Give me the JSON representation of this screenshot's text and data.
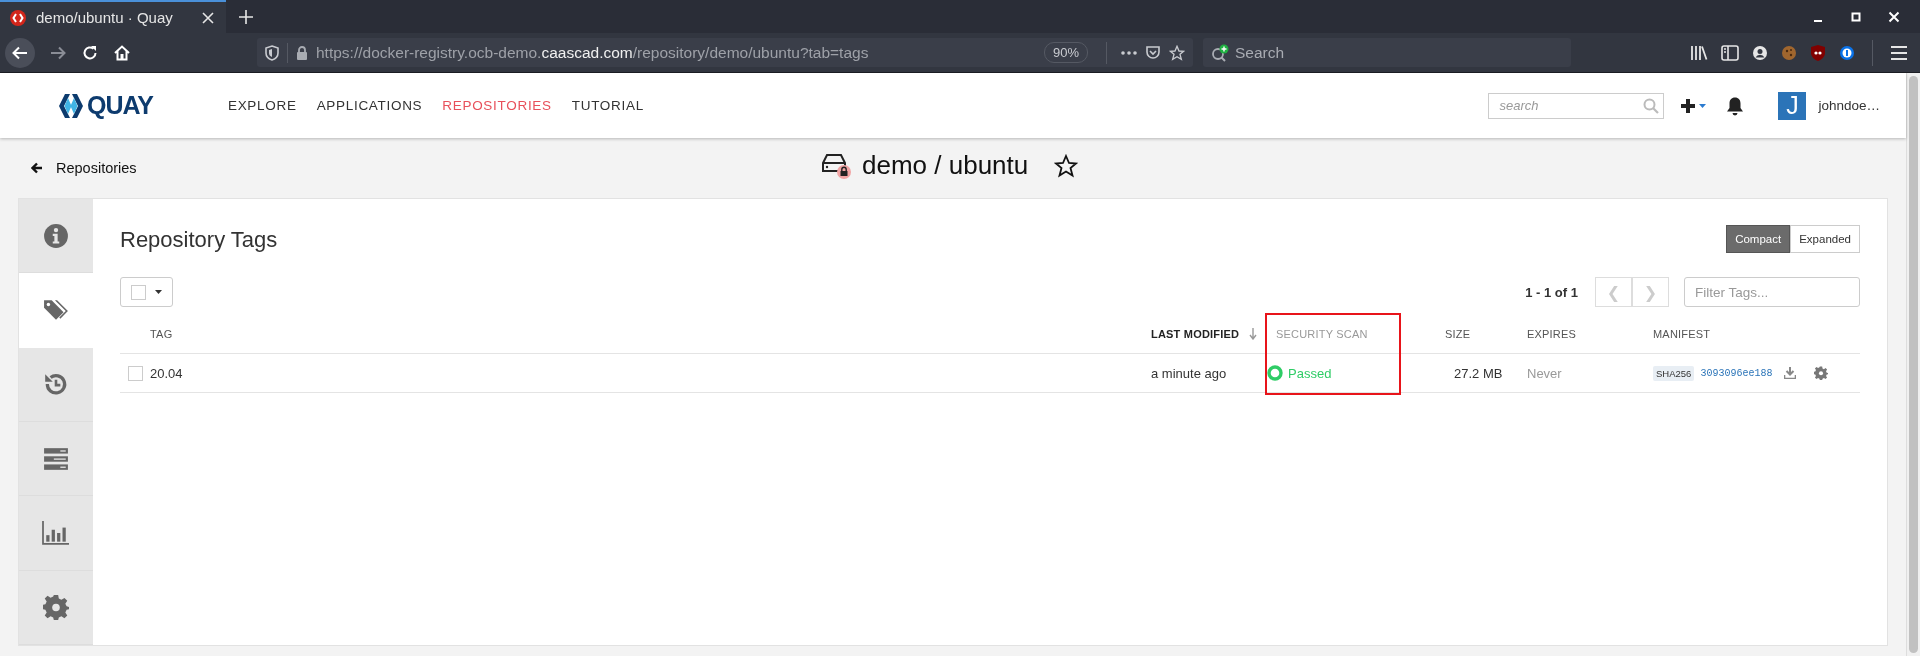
{
  "browser": {
    "tab": {
      "title": "demo/ubuntu · Quay",
      "selected": true
    },
    "url": {
      "prefix": "https://docker-registry.ocb-demo.",
      "domain": "caascad.com",
      "path": "/repository/demo/ubuntu?tab=tags"
    },
    "zoom": "90%",
    "search": {
      "placeholder": "Search"
    }
  },
  "app": {
    "logo": "QUAY",
    "nav": [
      {
        "label": "EXPLORE",
        "selected": false
      },
      {
        "label": "APPLICATIONS",
        "selected": false
      },
      {
        "label": "REPOSITORIES",
        "selected": true
      },
      {
        "label": "TUTORIAL",
        "selected": false
      }
    ],
    "search": {
      "placeholder": "search"
    },
    "user": {
      "initial": "J",
      "name": "johndoe…"
    }
  },
  "page": {
    "back": "Repositories",
    "title": "demo / ubuntu",
    "starred": false
  },
  "sidebar": {
    "items": [
      {
        "kind": "info",
        "selected": false
      },
      {
        "kind": "tags",
        "selected": true
      },
      {
        "kind": "history",
        "selected": false
      },
      {
        "kind": "builds",
        "selected": false
      },
      {
        "kind": "usage",
        "selected": false
      },
      {
        "kind": "settings",
        "selected": false
      }
    ]
  },
  "tags": {
    "title": "Repository Tags",
    "views": [
      {
        "label": "Compact",
        "selected": true
      },
      {
        "label": "Expanded",
        "selected": false
      }
    ],
    "select_all": {
      "checked": false
    },
    "pagination": "1 - 1 of 1",
    "prev": "❮",
    "next": "❯",
    "filter": {
      "placeholder": "Filter Tags..."
    },
    "columns": [
      {
        "label": "TAG",
        "sorted": false,
        "sortable": true,
        "highlighted": false
      },
      {
        "label": "LAST MODIFIED",
        "sorted": true,
        "sortable": true,
        "highlighted": false
      },
      {
        "label": "SECURITY SCAN",
        "sorted": false,
        "sortable": false,
        "highlighted": true
      },
      {
        "label": "SIZE",
        "sorted": false,
        "sortable": true,
        "highlighted": false
      },
      {
        "label": "EXPIRES",
        "sorted": false,
        "sortable": true,
        "highlighted": false
      },
      {
        "label": "MANIFEST",
        "sorted": false,
        "sortable": true,
        "highlighted": false
      }
    ],
    "rows": [
      {
        "checked": false,
        "tag": "20.04",
        "modified": "a minute ago",
        "scan": {
          "kind": "passed",
          "label": "Passed"
        },
        "size": "27.2 MB",
        "expires": "Never",
        "manifest": {
          "algorithm": "SHA256",
          "digest": "3093096ee188"
        }
      }
    ]
  }
}
